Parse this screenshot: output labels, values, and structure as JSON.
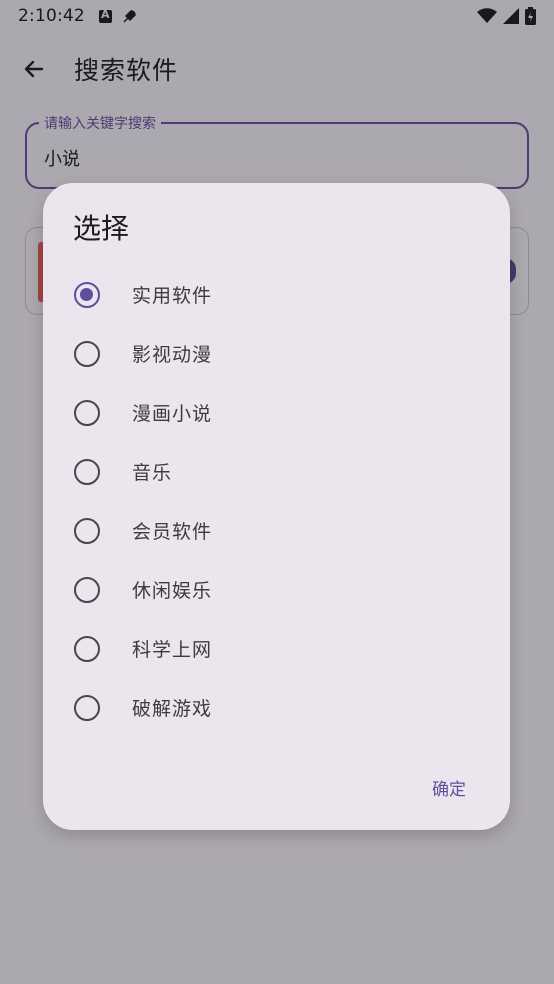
{
  "status": {
    "time": "2:10:42"
  },
  "app_bar": {
    "title": "搜索软件"
  },
  "search": {
    "label": "请输入关键字搜索",
    "value": "小说"
  },
  "dialog": {
    "title": "选择",
    "options": [
      {
        "label": "实用软件",
        "selected": true
      },
      {
        "label": "影视动漫",
        "selected": false
      },
      {
        "label": "漫画小说",
        "selected": false
      },
      {
        "label": "音乐",
        "selected": false
      },
      {
        "label": "会员软件",
        "selected": false
      },
      {
        "label": "休闲娱乐",
        "selected": false
      },
      {
        "label": "科学上网",
        "selected": false
      },
      {
        "label": "破解游戏",
        "selected": false
      }
    ],
    "confirm_label": "确定"
  },
  "colors": {
    "accent": "#5e4f9c",
    "scrim_bg": "#aca8af",
    "dialog_bg": "#ebe5ee"
  }
}
